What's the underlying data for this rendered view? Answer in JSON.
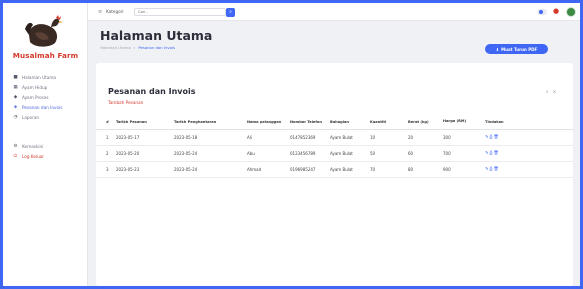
{
  "brand": {
    "name": "Musalmah Farm"
  },
  "sidebar": {
    "items": [
      {
        "label": "Halaman Utama",
        "icon": "home-icon"
      },
      {
        "label": "Ayam Hidup",
        "icon": "grid-icon"
      },
      {
        "label": "Ayam Proses",
        "icon": "chicken-icon"
      },
      {
        "label": "Pesanan dan Invois",
        "icon": "cart-icon",
        "active": true
      },
      {
        "label": "Laporan",
        "icon": "report-icon"
      }
    ],
    "bottom_items": [
      {
        "label": "Kemaskini",
        "icon": "gear-icon"
      },
      {
        "label": "Log Keluar",
        "icon": "logout-icon"
      }
    ]
  },
  "topbar": {
    "category_label": "Kategori",
    "search_placeholder": "Cari..."
  },
  "header": {
    "title": "Halaman Utama",
    "breadcrumb": [
      "Halaman Utama",
      "Pesanan dan Invois"
    ],
    "pdf_button": "Muat Turun PDF"
  },
  "card": {
    "title": "Pesanan dan Invois",
    "add_link": "Tambah Pesanan"
  },
  "table": {
    "columns": [
      "#",
      "Tarikh Pesanan",
      "Tarikh Penghantaran",
      "Nama pelanggan",
      "Nombor Telefon",
      "Bahagian",
      "Kuantiti",
      "Berat (kg)",
      "Harga (RM)",
      "Tindakan"
    ],
    "rows": [
      [
        "1",
        "2023-05-17",
        "2023-05-18",
        "Ali",
        "0147852369",
        "Ayam Bulat",
        "10",
        "20",
        "300"
      ],
      [
        "2",
        "2023-05-20",
        "2023-05-24",
        "Abu",
        "0123456789",
        "Ayam Bulat",
        "50",
        "60",
        "700"
      ],
      [
        "3",
        "2023-05-23",
        "2023-05-24",
        "Ahmad",
        "0196985247",
        "Ayam Bulat",
        "70",
        "80",
        "900"
      ]
    ]
  },
  "colors": {
    "accent": "#3f67f3",
    "brand": "#d33a2c",
    "background": "#f0f1f5"
  }
}
